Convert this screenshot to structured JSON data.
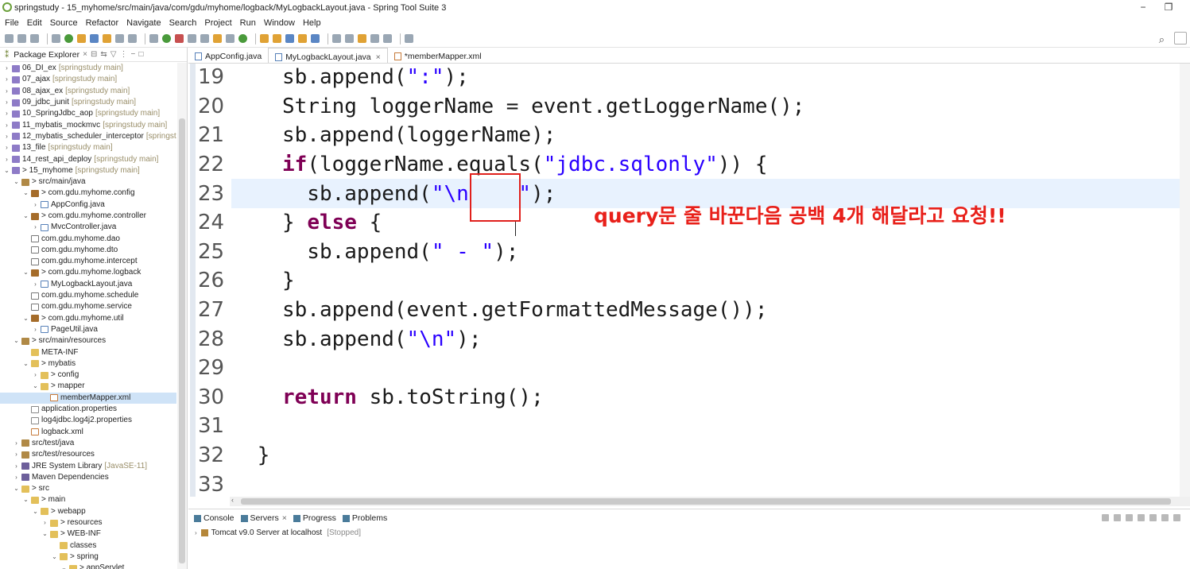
{
  "window": {
    "title": "springstudy - 15_myhome/src/main/java/com/gdu/myhome/logback/MyLogbackLayout.java - Spring Tool Suite 3"
  },
  "menu": [
    "File",
    "Edit",
    "Source",
    "Refactor",
    "Navigate",
    "Search",
    "Project",
    "Run",
    "Window",
    "Help"
  ],
  "left_panel": {
    "tab": "Package Explorer"
  },
  "tree": [
    {
      "t": "06_DI_ex",
      "dec": "[springstudy main]",
      "lvl": 0,
      "ic": "proj",
      "ar": ">"
    },
    {
      "t": "07_ajax",
      "dec": "[springstudy main]",
      "lvl": 0,
      "ic": "proj",
      "ar": ">"
    },
    {
      "t": "08_ajax_ex",
      "dec": "[springstudy main]",
      "lvl": 0,
      "ic": "proj",
      "ar": ">"
    },
    {
      "t": "09_jdbc_junit",
      "dec": "[springstudy main]",
      "lvl": 0,
      "ic": "proj",
      "ar": ">"
    },
    {
      "t": "10_SpringJdbc_aop",
      "dec": "[springstudy main]",
      "lvl": 0,
      "ic": "proj",
      "ar": ">"
    },
    {
      "t": "11_mybatis_mockmvc",
      "dec": "[springstudy main]",
      "lvl": 0,
      "ic": "proj",
      "ar": ">"
    },
    {
      "t": "12_mybatis_scheduler_interceptor",
      "dec": "[springstu",
      "lvl": 0,
      "ic": "proj",
      "ar": ">"
    },
    {
      "t": "13_file",
      "dec": "[springstudy main]",
      "lvl": 0,
      "ic": "proj",
      "ar": ">"
    },
    {
      "t": "14_rest_api_deploy",
      "dec": "[springstudy main]",
      "lvl": 0,
      "ic": "proj",
      "ar": ">"
    },
    {
      "t": "> 15_myhome",
      "dec": "[springstudy main]",
      "lvl": 0,
      "ic": "proj",
      "ar": "v"
    },
    {
      "t": "> src/main/java",
      "dec": "",
      "lvl": 1,
      "ic": "src",
      "ar": "v"
    },
    {
      "t": "> com.gdu.myhome.config",
      "dec": "",
      "lvl": 2,
      "ic": "pkg",
      "ar": "v"
    },
    {
      "t": "AppConfig.java",
      "dec": "",
      "lvl": 3,
      "ic": "java",
      "ar": ">"
    },
    {
      "t": "> com.gdu.myhome.controller",
      "dec": "",
      "lvl": 2,
      "ic": "pkg",
      "ar": "v"
    },
    {
      "t": "MvcController.java",
      "dec": "",
      "lvl": 3,
      "ic": "java",
      "ar": ">"
    },
    {
      "t": "com.gdu.myhome.dao",
      "dec": "",
      "lvl": 2,
      "ic": "pkgE",
      "ar": ""
    },
    {
      "t": "com.gdu.myhome.dto",
      "dec": "",
      "lvl": 2,
      "ic": "pkgE",
      "ar": ""
    },
    {
      "t": "com.gdu.myhome.intercept",
      "dec": "",
      "lvl": 2,
      "ic": "pkgE",
      "ar": ""
    },
    {
      "t": "> com.gdu.myhome.logback",
      "dec": "",
      "lvl": 2,
      "ic": "pkg",
      "ar": "v"
    },
    {
      "t": "MyLogbackLayout.java",
      "dec": "",
      "lvl": 3,
      "ic": "java",
      "ar": ">"
    },
    {
      "t": "com.gdu.myhome.schedule",
      "dec": "",
      "lvl": 2,
      "ic": "pkgE",
      "ar": ""
    },
    {
      "t": "com.gdu.myhome.service",
      "dec": "",
      "lvl": 2,
      "ic": "pkgE",
      "ar": ""
    },
    {
      "t": "> com.gdu.myhome.util",
      "dec": "",
      "lvl": 2,
      "ic": "pkg",
      "ar": "v"
    },
    {
      "t": "PageUtil.java",
      "dec": "",
      "lvl": 3,
      "ic": "java",
      "ar": ">"
    },
    {
      "t": "> src/main/resources",
      "dec": "",
      "lvl": 1,
      "ic": "src",
      "ar": "v"
    },
    {
      "t": "META-INF",
      "dec": "",
      "lvl": 2,
      "ic": "folder",
      "ar": ""
    },
    {
      "t": "> mybatis",
      "dec": "",
      "lvl": 2,
      "ic": "folder",
      "ar": "v"
    },
    {
      "t": "> config",
      "dec": "",
      "lvl": 3,
      "ic": "folder",
      "ar": ">"
    },
    {
      "t": "> mapper",
      "dec": "",
      "lvl": 3,
      "ic": "folder",
      "ar": "v"
    },
    {
      "t": "memberMapper.xml",
      "dec": "",
      "lvl": 4,
      "ic": "xml",
      "ar": "",
      "sel": true
    },
    {
      "t": "application.properties",
      "dec": "",
      "lvl": 2,
      "ic": "file",
      "ar": ""
    },
    {
      "t": "log4jdbc.log4j2.properties",
      "dec": "",
      "lvl": 2,
      "ic": "file",
      "ar": ""
    },
    {
      "t": "logback.xml",
      "dec": "",
      "lvl": 2,
      "ic": "xml",
      "ar": ""
    },
    {
      "t": "src/test/java",
      "dec": "",
      "lvl": 1,
      "ic": "src",
      "ar": ">"
    },
    {
      "t": "src/test/resources",
      "dec": "",
      "lvl": 1,
      "ic": "src",
      "ar": ">"
    },
    {
      "t": "JRE System Library",
      "dec": "[JavaSE-11]",
      "lvl": 1,
      "ic": "lib",
      "ar": ">"
    },
    {
      "t": "Maven Dependencies",
      "dec": "",
      "lvl": 1,
      "ic": "lib",
      "ar": ">"
    },
    {
      "t": "> src",
      "dec": "",
      "lvl": 1,
      "ic": "folder",
      "ar": "v"
    },
    {
      "t": "> main",
      "dec": "",
      "lvl": 2,
      "ic": "folder",
      "ar": "v"
    },
    {
      "t": "> webapp",
      "dec": "",
      "lvl": 3,
      "ic": "folder",
      "ar": "v"
    },
    {
      "t": "> resources",
      "dec": "",
      "lvl": 4,
      "ic": "folder",
      "ar": ">"
    },
    {
      "t": "> WEB-INF",
      "dec": "",
      "lvl": 4,
      "ic": "folder",
      "ar": "v"
    },
    {
      "t": "classes",
      "dec": "",
      "lvl": 5,
      "ic": "folder",
      "ar": ""
    },
    {
      "t": "> spring",
      "dec": "",
      "lvl": 5,
      "ic": "folder",
      "ar": "v"
    },
    {
      "t": "> appServlet",
      "dec": "",
      "lvl": 6,
      "ic": "folder",
      "ar": "v"
    }
  ],
  "editor_tabs": [
    {
      "label": "AppConfig.java",
      "active": false,
      "xml": false
    },
    {
      "label": "MyLogbackLayout.java",
      "active": true,
      "xml": false
    },
    {
      "label": "*memberMapper.xml",
      "active": false,
      "xml": true
    }
  ],
  "code_lines": [
    {
      "n": "19",
      "i": 4,
      "cur": false,
      "p": [
        [
          "",
          "sb.append("
        ],
        [
          "s",
          "\":\""
        ],
        [
          "",
          ");"
        ]
      ]
    },
    {
      "n": "20",
      "i": 4,
      "cur": false,
      "p": [
        [
          "",
          "String loggerName = event.getLoggerName();"
        ]
      ]
    },
    {
      "n": "21",
      "i": 4,
      "cur": false,
      "p": [
        [
          "",
          "sb.append(loggerName);"
        ]
      ]
    },
    {
      "n": "22",
      "i": 4,
      "cur": false,
      "p": [
        [
          "k",
          "if"
        ],
        [
          "",
          "(loggerName.equals("
        ],
        [
          "s",
          "\"jdbc.sqlonly\""
        ],
        [
          "",
          "))"
        ],
        [
          "",
          " {"
        ]
      ]
    },
    {
      "n": "23",
      "i": 6,
      "cur": true,
      "p": [
        [
          "",
          "sb.append("
        ],
        [
          "s",
          "\"\\n    \""
        ],
        [
          "",
          ");"
        ]
      ]
    },
    {
      "n": "24",
      "i": 4,
      "cur": false,
      "p": [
        [
          "",
          "} "
        ],
        [
          "k",
          "else"
        ],
        [
          "",
          " {"
        ]
      ]
    },
    {
      "n": "25",
      "i": 6,
      "cur": false,
      "p": [
        [
          "",
          "sb.append("
        ],
        [
          "s",
          "\" - \""
        ],
        [
          "",
          ");"
        ]
      ]
    },
    {
      "n": "26",
      "i": 4,
      "cur": false,
      "p": [
        [
          "",
          "}"
        ]
      ]
    },
    {
      "n": "27",
      "i": 4,
      "cur": false,
      "p": [
        [
          "",
          "sb.append(event.getFormattedMessage());"
        ]
      ]
    },
    {
      "n": "28",
      "i": 4,
      "cur": false,
      "p": [
        [
          "",
          "sb.append("
        ],
        [
          "s",
          "\"\\n\""
        ],
        [
          "",
          ");"
        ]
      ]
    },
    {
      "n": "29",
      "i": 0,
      "cur": false,
      "p": []
    },
    {
      "n": "30",
      "i": 4,
      "cur": false,
      "p": [
        [
          "k",
          "return"
        ],
        [
          "",
          " sb.toString();"
        ]
      ]
    },
    {
      "n": "31",
      "i": 0,
      "cur": false,
      "p": []
    },
    {
      "n": "32",
      "i": 2,
      "cur": false,
      "p": [
        [
          "",
          "}"
        ]
      ]
    },
    {
      "n": "33",
      "i": 0,
      "cur": false,
      "p": []
    }
  ],
  "annotation": "query문 줄 바꾼다음  공백 4개 해달라고 요청!!",
  "bottom_tabs": [
    {
      "label": "Console",
      "active": false
    },
    {
      "label": "Servers",
      "active": true
    },
    {
      "label": "Progress",
      "active": false
    },
    {
      "label": "Problems",
      "active": false
    }
  ],
  "server": {
    "name": "Tomcat v9.0 Server at localhost",
    "status": "[Stopped]"
  },
  "colors": {
    "keyword": "#7f0055",
    "string": "#2a00ff",
    "annotation": "#e8201a",
    "current_line": "#e8f2fe"
  }
}
